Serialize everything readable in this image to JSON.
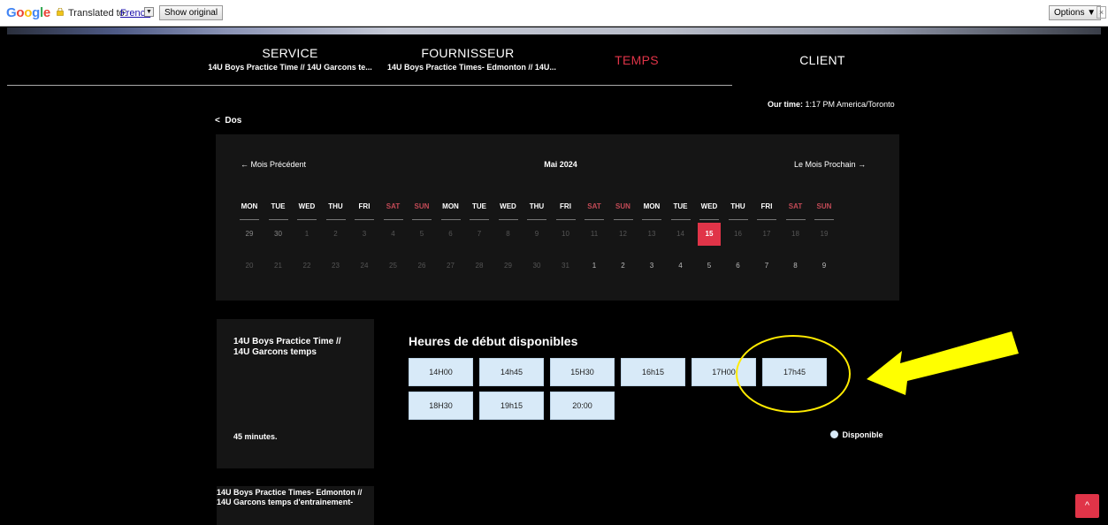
{
  "translate_bar": {
    "logo_letters": [
      "G",
      "o",
      "o",
      "g",
      "l",
      "e"
    ],
    "logo_colors": [
      "#4285f4",
      "#ea4335",
      "#fbbc05",
      "#4285f4",
      "#34a853",
      "#ea4335"
    ],
    "translated_label": "Translated to:",
    "language": "French",
    "show_original": "Show original",
    "options": "Options ▼",
    "close": "×"
  },
  "steps": {
    "service": {
      "title": "SERVICE",
      "sub": "14U Boys Practice Time // 14U Garcons te..."
    },
    "fournisseur": {
      "title": "FOURNISSEUR",
      "sub": "14U Boys Practice Times- Edmonton // 14U..."
    },
    "temps": {
      "title": "TEMPS"
    },
    "client": {
      "title": "CLIENT"
    }
  },
  "our_time": {
    "label": "Our time:",
    "value": "1:17 PM America/Toronto"
  },
  "back": "Dos",
  "calendar": {
    "prev": "Mois Précédent",
    "month": "Mai 2024",
    "next": "Le Mois Prochain",
    "weekdays": [
      "MON",
      "TUE",
      "WED",
      "THU",
      "FRI",
      "SAT",
      "SUN",
      "MON",
      "TUE",
      "WED",
      "THU",
      "FRI",
      "SAT",
      "SUN",
      "MON",
      "TUE",
      "WED",
      "THU",
      "FRI",
      "SAT",
      "SUN"
    ],
    "row1": [
      "29",
      "30",
      "1",
      "2",
      "3",
      "4",
      "5",
      "6",
      "7",
      "8",
      "9",
      "10",
      "11",
      "12",
      "13",
      "14",
      "15",
      "16",
      "17",
      "18",
      "19"
    ],
    "row2": [
      "20",
      "21",
      "22",
      "23",
      "24",
      "25",
      "26",
      "27",
      "28",
      "29",
      "30",
      "31",
      "1",
      "2",
      "3",
      "4",
      "5",
      "6",
      "7",
      "8",
      "9"
    ],
    "selected_day": "15",
    "accent": "#e03448"
  },
  "service_card": {
    "name": "14U Boys Practice Time // 14U Garcons temps",
    "duration": "45 minutes."
  },
  "provider_card": {
    "name": "14U Boys Practice Times- Edmonton // 14U Garcons temps d'entrainement-"
  },
  "times": {
    "title": "Heures de début disponibles",
    "slots": [
      "14H00",
      "14h45",
      "15H30",
      "16h15",
      "17H00",
      "17h45",
      "18H30",
      "19h15",
      "20:00"
    ]
  },
  "legend": {
    "label": "Disponible"
  },
  "scroll_top": "^"
}
